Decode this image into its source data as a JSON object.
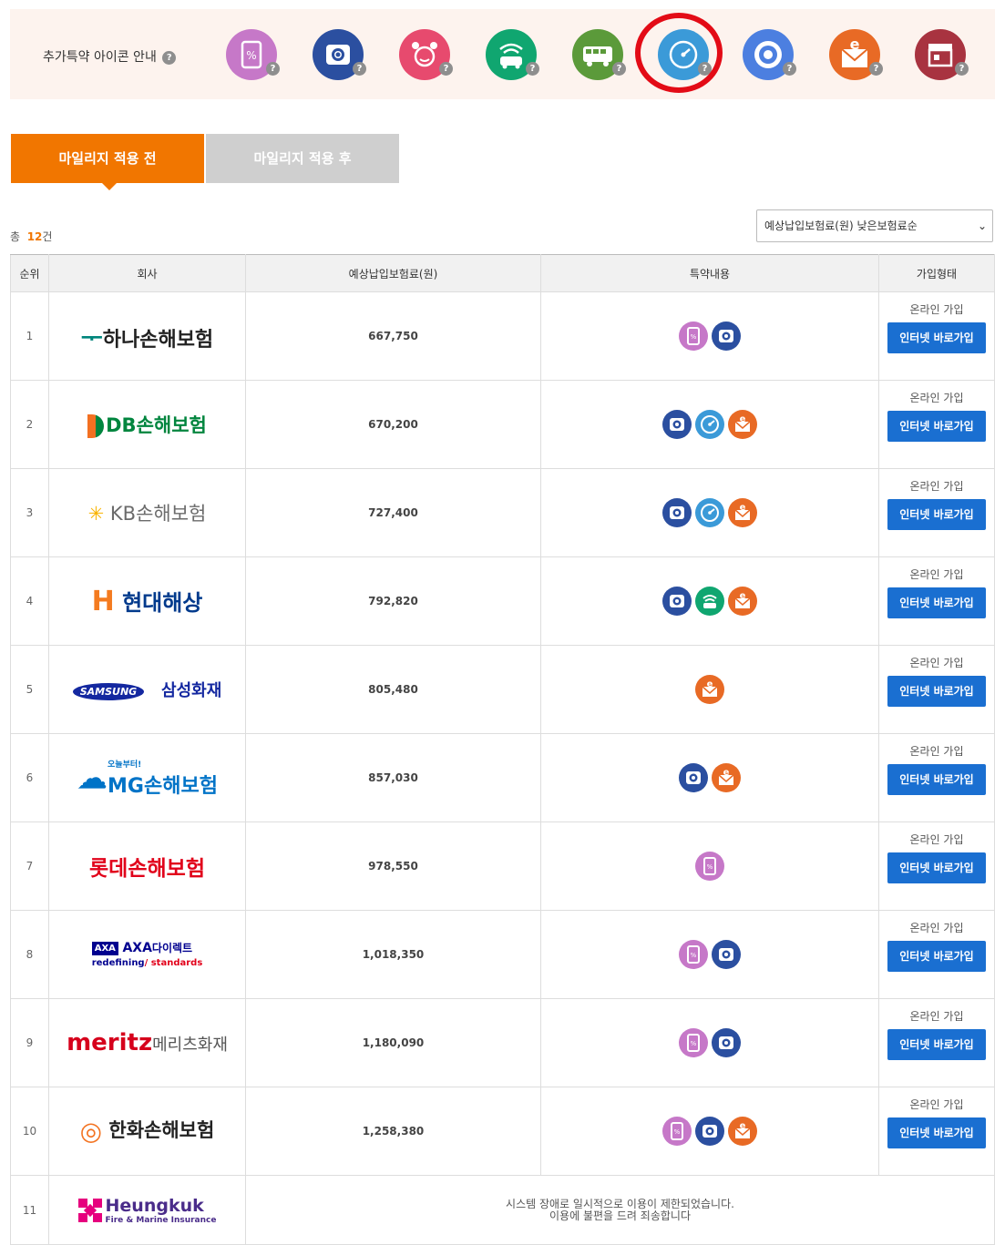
{
  "iconbar": {
    "label": "추가특약 아이콘 안내",
    "help": "?",
    "icons": [
      {
        "name": "mobile-discount-icon",
        "color": "#c678c8"
      },
      {
        "name": "blackbox-icon",
        "color": "#2b4fa0"
      },
      {
        "name": "child-icon",
        "color": "#e74a6e"
      },
      {
        "name": "connected-car-icon",
        "color": "#10a670"
      },
      {
        "name": "bus-icon",
        "color": "#5b9a3a"
      },
      {
        "name": "mileage-icon",
        "color": "#3b9ad8"
      },
      {
        "name": "tire-icon",
        "color": "#4c7fe0"
      },
      {
        "name": "email-icon",
        "color": "#e86a25"
      },
      {
        "name": "store-icon",
        "color": "#a83340"
      }
    ]
  },
  "tabs": {
    "before": "마일리지 적용 전",
    "after": "마일리지 적용 후"
  },
  "summary": {
    "prefix": "총",
    "count": "12",
    "suffix": "건"
  },
  "sort": {
    "selected": "예상납입보험료(원) 낮은보험료순"
  },
  "table": {
    "headers": {
      "rank": "순위",
      "company": "회사",
      "premium": "예상납입보험료(원)",
      "options": "특약내용",
      "join": "가입형태"
    },
    "online_label": "온라인 가입",
    "button_label": "인터넷 바로가입",
    "rows": [
      {
        "rank": "1",
        "company": "하나손해보험",
        "premium": "667,750",
        "icons": [
          "mobile",
          "blackbox"
        ]
      },
      {
        "rank": "2",
        "company": "DB손해보험",
        "premium": "670,200",
        "icons": [
          "blackbox",
          "mileage",
          "email"
        ]
      },
      {
        "rank": "3",
        "company": "KB손해보험",
        "premium": "727,400",
        "icons": [
          "blackbox",
          "mileage",
          "email"
        ]
      },
      {
        "rank": "4",
        "company": "현대해상",
        "premium": "792,820",
        "icons": [
          "blackbox",
          "connected",
          "email"
        ]
      },
      {
        "rank": "5",
        "company": "삼성화재",
        "premium": "805,480",
        "icons": [
          "email"
        ]
      },
      {
        "rank": "6",
        "company": "MG손해보험",
        "premium": "857,030",
        "icons": [
          "blackbox",
          "email"
        ]
      },
      {
        "rank": "7",
        "company": "롯데손해보험",
        "premium": "978,550",
        "icons": [
          "mobile"
        ]
      },
      {
        "rank": "8",
        "company": "AXA다이렉트",
        "premium": "1,018,350",
        "icons": [
          "mobile",
          "blackbox"
        ]
      },
      {
        "rank": "9",
        "company": "메리츠화재",
        "premium": "1,180,090",
        "icons": [
          "mobile",
          "blackbox"
        ]
      },
      {
        "rank": "10",
        "company": "한화손해보험",
        "premium": "1,258,380",
        "icons": [
          "mobile",
          "blackbox",
          "email"
        ]
      }
    ],
    "last": {
      "rank": "11",
      "company": "Heungkuk",
      "notice1": "시스템 장애로 일시적으로 이용이 제한되었습니다.",
      "notice2": "이용에 불편을 드려 죄송합니다"
    }
  },
  "logos": {
    "hana": "하나손해보험",
    "db_mark": "DB",
    "db_text": "손해보험",
    "kb_mark": "KB",
    "kb_text": "손해보험",
    "hyundai_mark": "H",
    "hyundai_text": "현대해상",
    "samsung_mark": "SAMSUNG",
    "samsung_text": "삼성화재",
    "mg_tag": "오늘부터!",
    "mg_mark": "MG",
    "mg_text": "손해보험",
    "lotte": "롯데손해보험",
    "axa_mark": "AXA",
    "axa_text": "AXA",
    "axa_kr": "다이렉트",
    "axa_tag1": "redefining",
    "axa_tag2": "/ standards",
    "meritz_mark": "meritz",
    "meritz_text": "메리츠화재",
    "hanwha": "한화손해보험",
    "heungkuk_text": "Heungkuk",
    "heungkuk_sub": "Fire & Marine Insurance"
  },
  "icon_colors": {
    "mobile": "#c678c8",
    "blackbox": "#2b4fa0",
    "connected": "#10a670",
    "mileage": "#3b9ad8",
    "email": "#e86a25"
  }
}
